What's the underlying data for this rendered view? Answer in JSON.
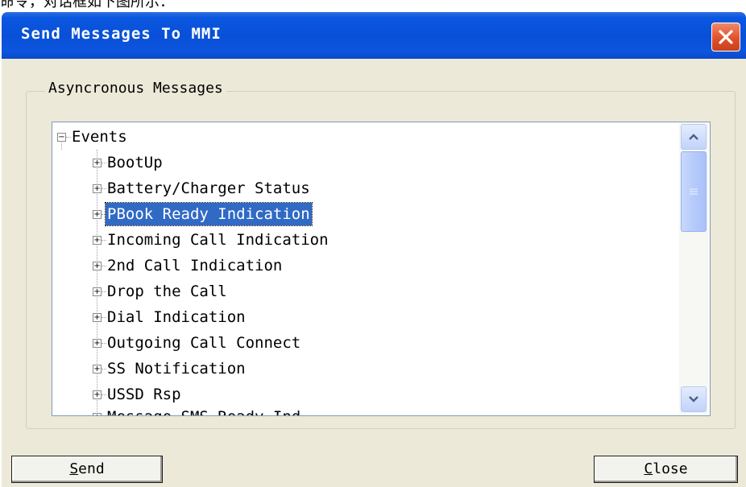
{
  "context_text": "命令，对话框如下图所示：",
  "window": {
    "title": "Send Messages To MMI"
  },
  "group": {
    "label": "Asyncronous Messages"
  },
  "tree": {
    "root": {
      "label": "Events",
      "expanded": true
    },
    "items": [
      {
        "label": "BootUp",
        "selected": false
      },
      {
        "label": "Battery/Charger Status",
        "selected": false
      },
      {
        "label": "PBook Ready Indication",
        "selected": true
      },
      {
        "label": "Incoming Call Indication",
        "selected": false
      },
      {
        "label": "2nd Call Indication",
        "selected": false
      },
      {
        "label": "Drop the Call",
        "selected": false
      },
      {
        "label": "Dial Indication",
        "selected": false
      },
      {
        "label": "Outgoing Call Connect",
        "selected": false
      },
      {
        "label": "SS Notification",
        "selected": false
      },
      {
        "label": "USSD Rsp",
        "selected": false
      }
    ],
    "partial_item": "Message SMS Ready Ind"
  },
  "buttons": {
    "send": {
      "accel": "S",
      "rest": "end"
    },
    "close": {
      "accel": "C",
      "rest": "lose"
    }
  },
  "colors": {
    "titlebar": "#0a57e0",
    "selection": "#316ac5",
    "close_button": "#e0512b",
    "dialog_bg": "#ece9d8"
  }
}
